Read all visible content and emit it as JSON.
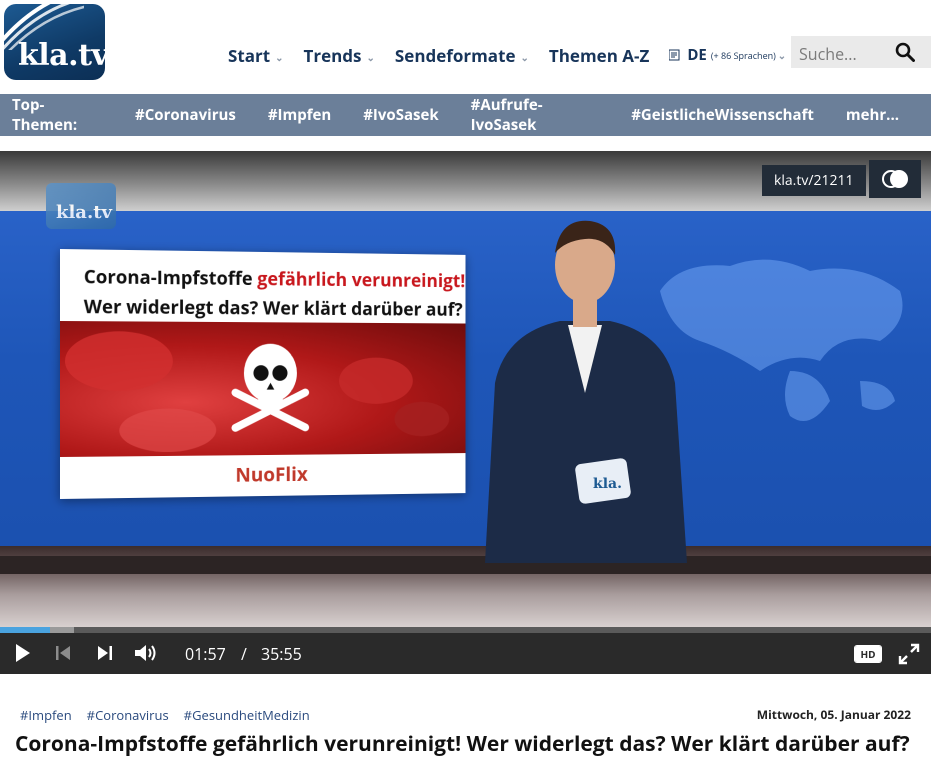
{
  "brand": {
    "logo_text": "kla.tv"
  },
  "nav": {
    "items": [
      {
        "label": "Start",
        "has_dropdown": true
      },
      {
        "label": "Trends",
        "has_dropdown": true
      },
      {
        "label": "Sendeformate",
        "has_dropdown": true
      },
      {
        "label": "Themen A-Z",
        "has_dropdown": false
      }
    ],
    "language": {
      "code": "DE",
      "more": "(+ 86 Sprachen)"
    }
  },
  "search": {
    "placeholder": "Suche..."
  },
  "topics": {
    "label": "Top-Themen:",
    "tags": [
      "#Coronavirus",
      "#Impfen",
      "#IvoSasek",
      "#Aufrufe-IvoSasek",
      "#GeistlicheWissenschaft",
      "mehr..."
    ]
  },
  "video": {
    "overlay_logo": "kla.tv",
    "panel_line1_black": "Corona-Impfstoffe",
    "panel_line1_red": "gefährlich verunreinigt!",
    "panel_line2": "Wer widerlegt das?   Wer klärt darüber auf?",
    "panel_brand": "NuoFlix",
    "id_badge": "kla.tv/21211",
    "current_time": "01:57",
    "separator": "/",
    "duration": "35:55",
    "progress": 0.054,
    "buffered": 0.08,
    "quality": "HD"
  },
  "article": {
    "tags": [
      "#Impfen",
      "#Coronavirus",
      "#GesundheitMedizin"
    ],
    "date": "Mittwoch, 05. Januar 2022",
    "title": "Corona-Impfstoffe gefährlich verunreinigt! Wer widerlegt das? Wer klärt darüber auf?"
  },
  "colors": {
    "nav_text": "#18355a",
    "topic_bar": "#6b7f99",
    "progress": "#4aa3df",
    "accent_red": "#c8171d"
  }
}
